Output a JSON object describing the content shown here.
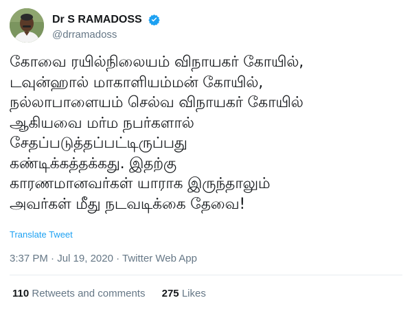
{
  "author": {
    "display_name": "Dr S RAMADOSS",
    "handle": "@drramadoss",
    "avatar_icon": "profile-photo",
    "verified_icon": "verified-badge-icon",
    "verified_color": "#1da1f2"
  },
  "tweet": {
    "text": "கோவை ரயில்நிலையம்  விநாயகர் கோயில்,\nடவுன்ஹால்  மாகாளியம்மன் கோயில்,\nநல்லாபாளையம் செல்வ விநாயகர் கோயில்\nஆகியவை மர்ம நபர்களால்\nசேதப்படுத்தப்பட்டிருப்பது\nகண்டிக்கத்தக்கது.  இதற்கு\nகாரணமானவர்கள் யாராக இருந்தாலும்\nஅவர்கள் மீது நடவடிக்கை தேவை!",
    "translate_label": "Translate Tweet"
  },
  "meta": {
    "time": "3:37 PM",
    "separator": " · ",
    "date": "Jul 19, 2020",
    "source": "Twitter Web App"
  },
  "stats": {
    "retweets_count": "110",
    "retweets_label": "Retweets and comments",
    "likes_count": "275",
    "likes_label": "Likes"
  },
  "colors": {
    "link": "#1da1f2",
    "muted": "#657786",
    "text": "#14171a"
  }
}
